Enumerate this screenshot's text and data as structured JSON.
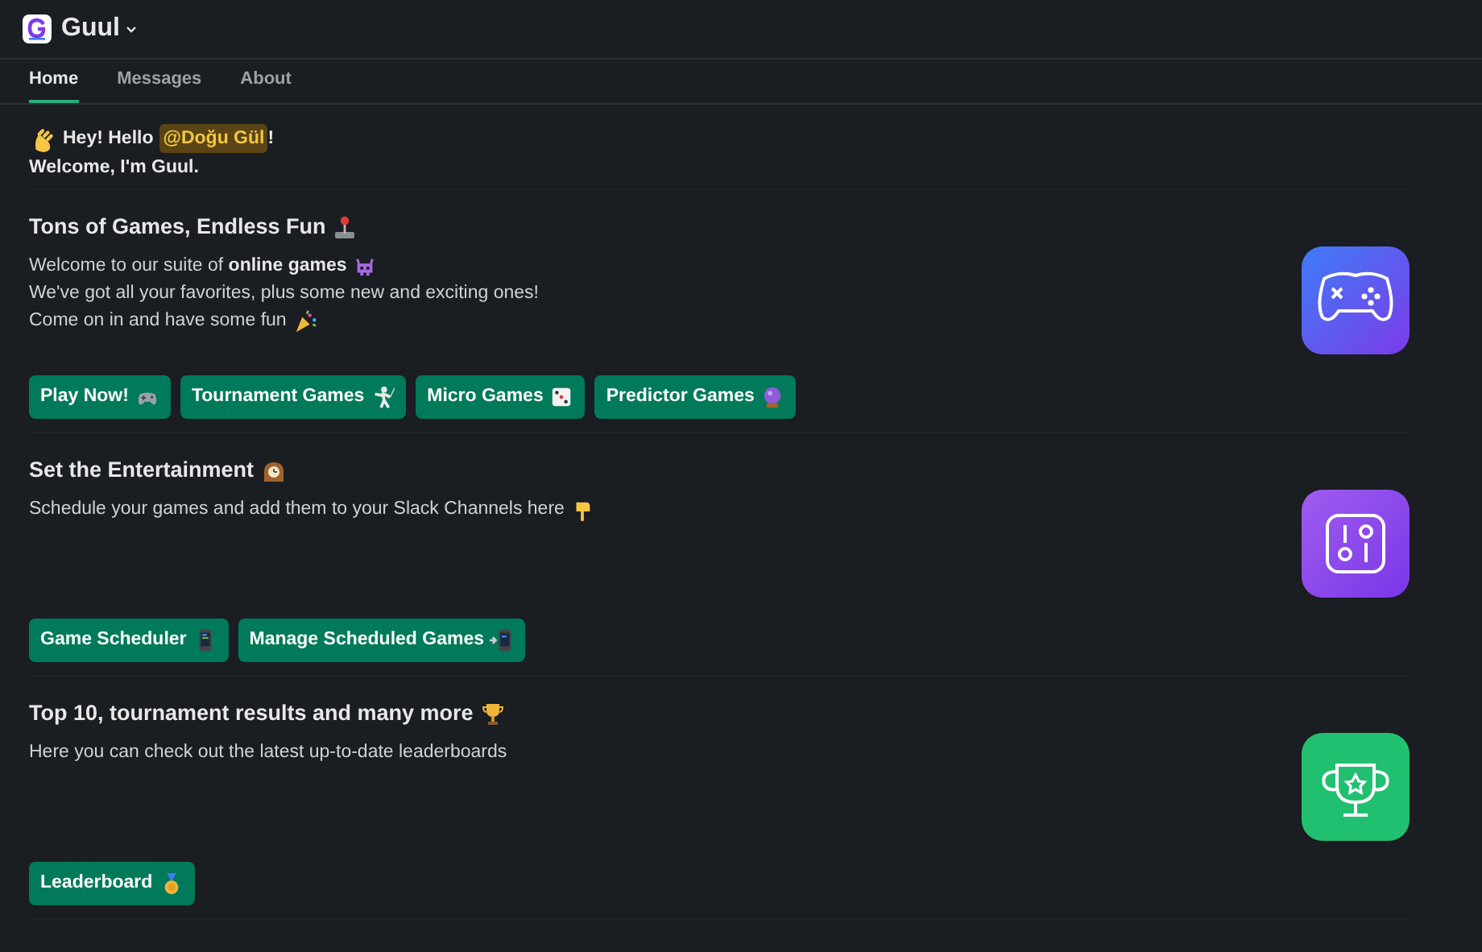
{
  "app": {
    "name": "Guul"
  },
  "tabs": [
    {
      "label": "Home",
      "selected": true
    },
    {
      "label": "Messages",
      "selected": false
    },
    {
      "label": "About",
      "selected": false
    }
  ],
  "greeting": {
    "prefix": "Hey! Hello",
    "mention": "@Doğu Gül",
    "suffix": "!",
    "line2": "Welcome, I'm Guul."
  },
  "sections": [
    {
      "title": "Tons of Games, Endless Fun",
      "lines": [
        "Welcome to our suite of **online games**",
        "We've got all your favorites, plus some new and exciting ones!",
        "Come on in and have some fun"
      ],
      "buttons": [
        "Play Now!",
        "Tournament Games",
        "Micro Games",
        "Predictor Games"
      ]
    },
    {
      "title": "Set the Entertainment",
      "lines": [
        "Schedule your games and add them to your Slack Channels here"
      ],
      "buttons": [
        "Game Scheduler",
        "Manage Scheduled Games"
      ]
    },
    {
      "title": "Top 10, tournament results and many more",
      "lines": [
        "Here you can check out the latest up-to-date leaderboards"
      ],
      "buttons": [
        "Leaderboard"
      ]
    }
  ]
}
